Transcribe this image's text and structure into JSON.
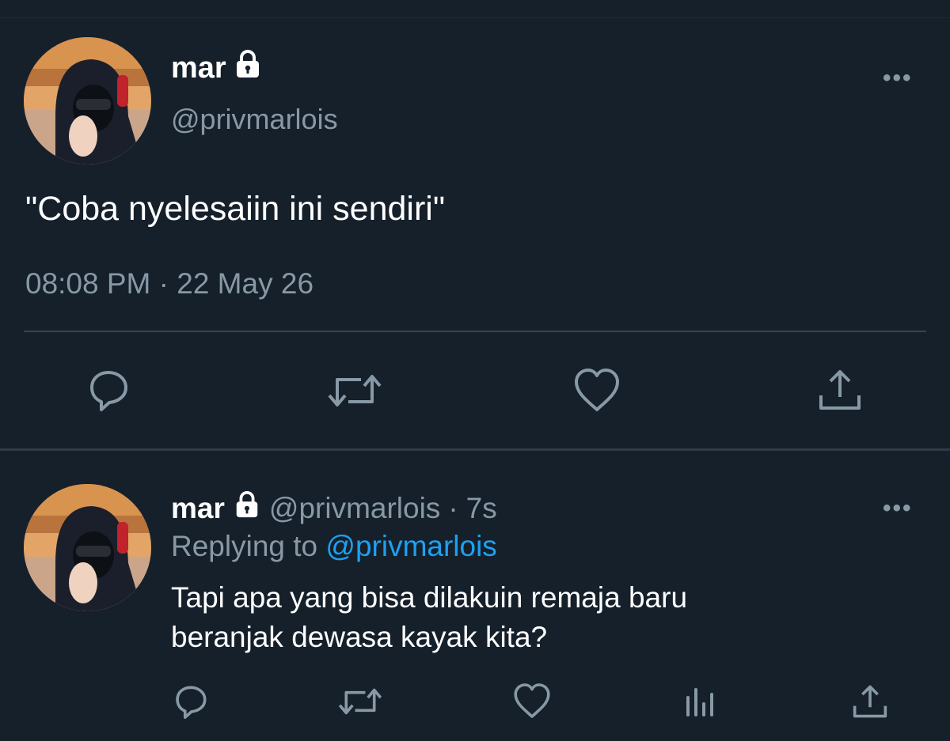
{
  "tweet": {
    "name": "mar",
    "handle": "@privmarlois",
    "text": "\"Coba nyelesaiin ini sendiri\"",
    "timestamp": "08:08 PM · 22 May 26",
    "more": "•••"
  },
  "reply": {
    "name": "mar",
    "handle": "@privmarlois",
    "separator": "·",
    "age": "7s",
    "replying_prefix": "Replying to",
    "replying_to": "@privmarlois",
    "text_line1": "Tapi apa yang bisa dilakuin remaja baru",
    "text_line2": "beranjak dewasa kayak kita?",
    "more": "•••"
  },
  "icons": {
    "lock": "lock-icon",
    "reply": "reply-icon",
    "retweet": "retweet-icon",
    "like": "heart-icon",
    "share": "share-icon",
    "analytics": "analytics-icon"
  },
  "colors": {
    "background": "#15202b",
    "secondary_text": "#8899a6",
    "link": "#1da1f2",
    "divider": "#38444d"
  }
}
